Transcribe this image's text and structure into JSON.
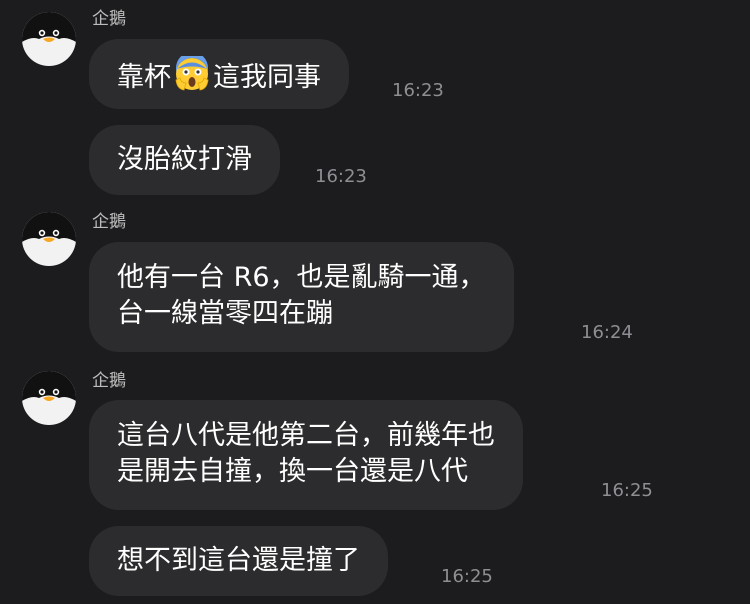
{
  "colors": {
    "background": "#1c1c1e",
    "bubble": "#2c2c2e",
    "text": "#ffffff",
    "sender": "#bdbdbd",
    "timestamp": "#8e8e93",
    "avatar_bg": "#f2f2f2"
  },
  "messages": [
    {
      "sender": "企鵝",
      "avatar": "penguin-icon",
      "text_before_emoji": "靠杯",
      "emoji": "face-screaming-in-fear-icon",
      "text_after_emoji": "這我同事",
      "time": "16:23"
    },
    {
      "text": "沒胎紋打滑",
      "time": "16:23"
    },
    {
      "sender": "企鵝",
      "avatar": "penguin-icon",
      "lines": [
        "他有一台 R6，也是亂騎一通，",
        "台一線當零四在蹦"
      ],
      "time": "16:24"
    },
    {
      "sender": "企鵝",
      "avatar": "penguin-icon",
      "lines": [
        "這台八代是他第二台，前幾年也",
        "是開去自撞，換一台還是八代"
      ],
      "time": "16:25"
    },
    {
      "text": "想不到這台還是撞了",
      "time": "16:25"
    }
  ]
}
